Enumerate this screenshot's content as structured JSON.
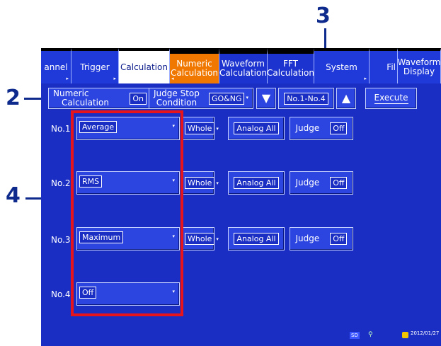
{
  "callouts": {
    "c2": "2",
    "c3": "3",
    "c4": "4"
  },
  "tabs": {
    "channel": "annel",
    "trigger": "Trigger",
    "calculation": "Calculation",
    "numeric_line1": "Numeric",
    "numeric_line2": "Calculation",
    "waveform_line1": "Waveform",
    "waveform_line2": "Calculation",
    "fft_line1": "FFT",
    "fft_line2": "Calculation",
    "system": "System",
    "file": "Fil",
    "waveform_display_line1": "Waveform",
    "waveform_display_line2": "Display"
  },
  "controls": {
    "numeric_calc_line1": "Numeric",
    "numeric_calc_line2": "Calculation",
    "numeric_calc_value": "On",
    "judge_stop_line1": "Judge Stop",
    "judge_stop_line2": "Condition",
    "judge_stop_value": "GO&NG",
    "range_value": "No.1-No.4",
    "execute": "Execute"
  },
  "rows": [
    {
      "label": "No.1",
      "calc": "Average",
      "scope": "Whole",
      "channel": "Analog All",
      "judge_label": "Judge",
      "judge": "Off"
    },
    {
      "label": "No.2",
      "calc": "RMS",
      "scope": "Whole",
      "channel": "Analog All",
      "judge_label": "Judge",
      "judge": "Off"
    },
    {
      "label": "No.3",
      "calc": "Maximum",
      "scope": "Whole",
      "channel": "Analog All",
      "judge_label": "Judge",
      "judge": "Off"
    },
    {
      "label": "No.4",
      "calc": "Off"
    }
  ],
  "status": {
    "sd": "SD",
    "datetime": "2012/01/27"
  },
  "colors": {
    "screen": "#1a2ec4",
    "accent_tab": "#f07800",
    "highlight": "#e8141c",
    "callout": "#0d2a8c"
  }
}
